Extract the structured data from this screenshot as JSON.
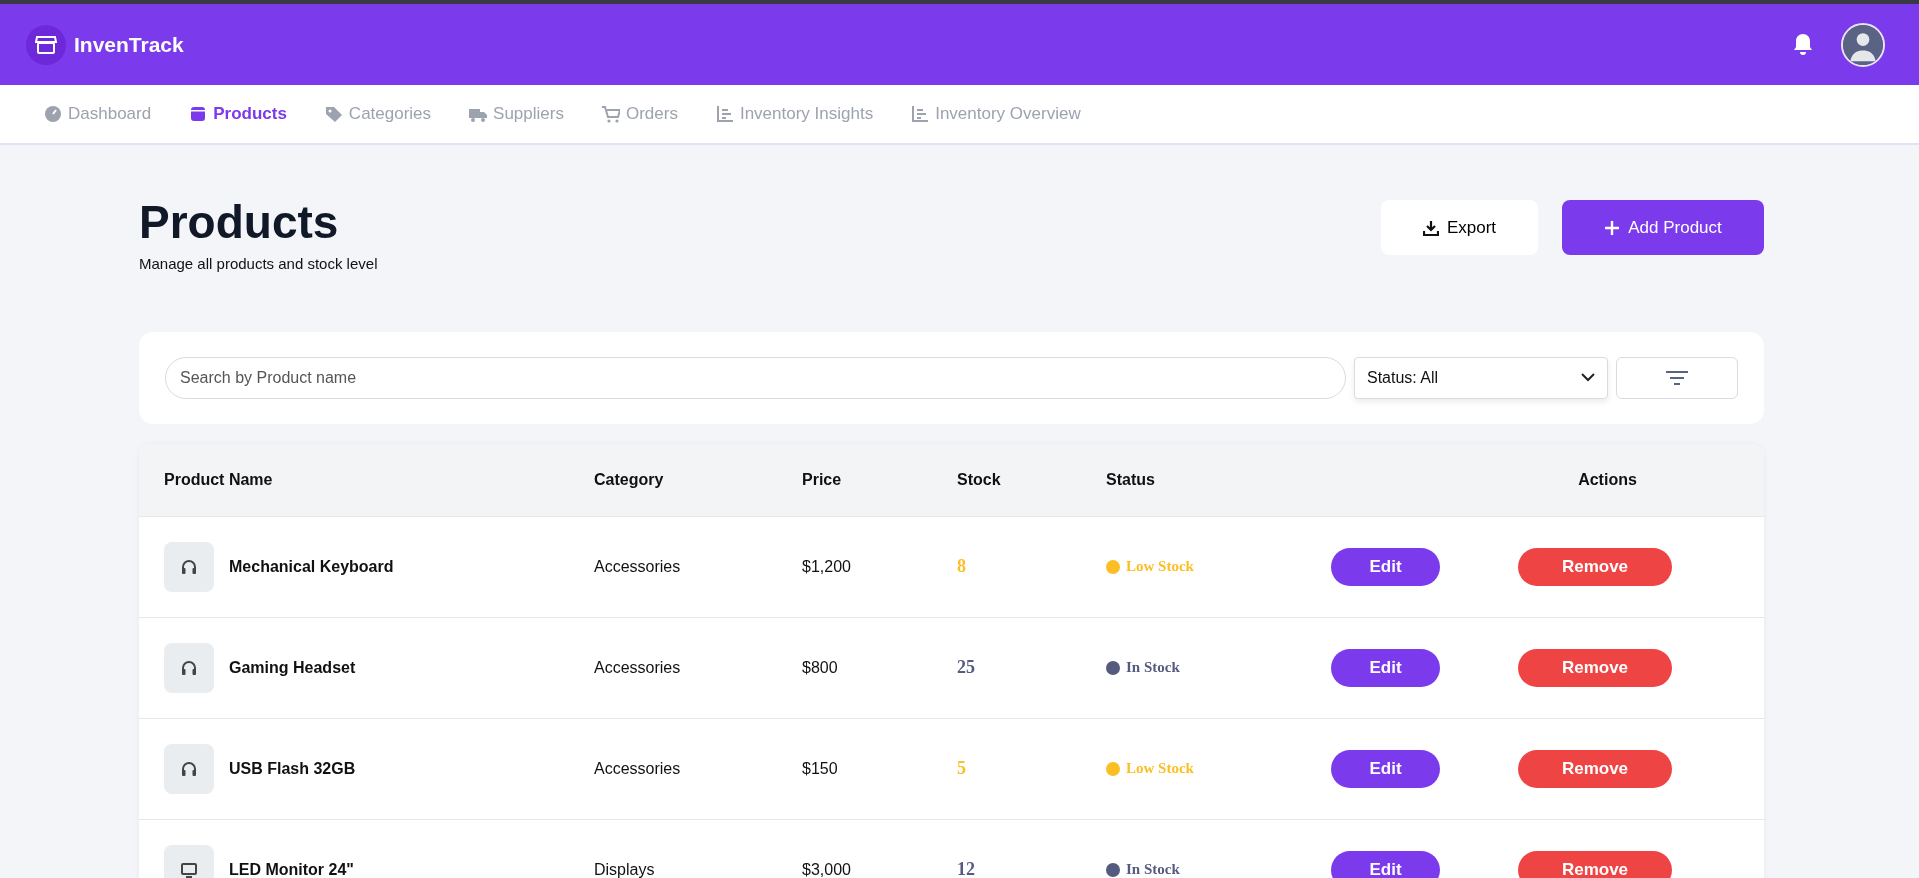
{
  "brand": {
    "name": "InvenTrack"
  },
  "nav": [
    {
      "label": "Dashboard",
      "selected": false
    },
    {
      "label": "Products",
      "selected": true
    },
    {
      "label": "Categories",
      "selected": false
    },
    {
      "label": "Suppliers",
      "selected": false
    },
    {
      "label": "Orders",
      "selected": false
    },
    {
      "label": "Inventory Insights",
      "selected": false
    },
    {
      "label": "Inventory Overview",
      "selected": false
    }
  ],
  "page": {
    "title": "Products",
    "subtitle": "Manage all products and stock level"
  },
  "buttons": {
    "export": "Export",
    "add": "Add Product"
  },
  "filters": {
    "search_placeholder": "Search by Product name",
    "status": "Status: All"
  },
  "table": {
    "columns": [
      "Product Name",
      "Category",
      "Price",
      "Stock",
      "Status",
      "Actions"
    ],
    "rows": [
      {
        "name": "Mechanical Keyboard",
        "category": "Accessories",
        "price": "$1,200",
        "stock": "8",
        "status": "Low Stock",
        "color": "#fbbf24",
        "edit": "Edit",
        "remove": "Remove"
      },
      {
        "name": "Gaming Headset",
        "category": "Accessories",
        "price": "$800",
        "stock": "25",
        "status": "In Stock",
        "color": "#545b7e",
        "edit": "Edit",
        "remove": "Remove"
      },
      {
        "name": "USB Flash 32GB",
        "category": "Accessories",
        "price": "$150",
        "stock": "5",
        "status": "Low Stock",
        "color": "#fbbf24",
        "edit": "Edit",
        "remove": "Remove"
      },
      {
        "name": "LED Monitor 24\"",
        "category": "Displays",
        "price": "$3,000",
        "stock": "12",
        "status": "In Stock",
        "color": "#545b7e",
        "edit": "Edit",
        "remove": "Remove"
      }
    ]
  }
}
